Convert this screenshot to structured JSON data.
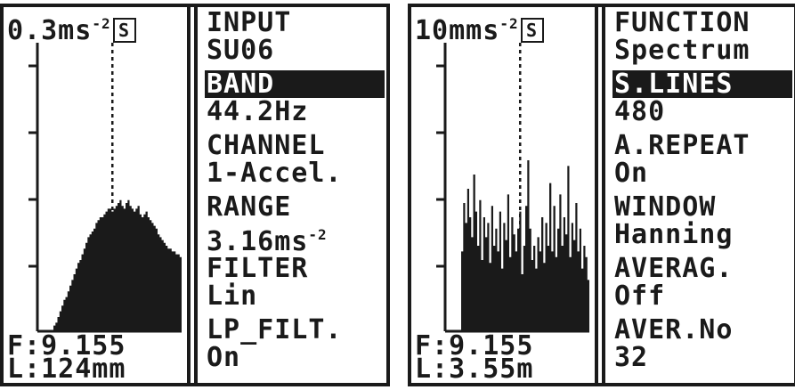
{
  "screens": [
    {
      "scale_value": "0.3ms",
      "scale_exp": "-2",
      "auto_glyph": "S",
      "readout_f": "F:9.155",
      "readout_l": "L:124mm",
      "spectrum": [
        0,
        0,
        0,
        0,
        0,
        0,
        0,
        0,
        2,
        3,
        5,
        7,
        9,
        11,
        12,
        14,
        16,
        18,
        20,
        22,
        24,
        25,
        27,
        29,
        31,
        33,
        34,
        35,
        36,
        38,
        39,
        40,
        40,
        41,
        42,
        43,
        43,
        42,
        43,
        44,
        45,
        46,
        44,
        43,
        45,
        46,
        44,
        43,
        42,
        43,
        44,
        41,
        40,
        41,
        42,
        40,
        39,
        38,
        37,
        36,
        34,
        33,
        32,
        31,
        30,
        29,
        29,
        28,
        28,
        27,
        27,
        26
      ],
      "menu": [
        {
          "label": "INPUT",
          "value": "SU06",
          "selected": false
        },
        {
          "label": "BAND",
          "value": "44.2Hz",
          "selected": true
        },
        {
          "label": "CHANNEL",
          "value": "1-Accel.",
          "selected": false
        },
        {
          "label": "RANGE",
          "value": "3.16ms",
          "value_exp": "-2",
          "selected": false
        },
        {
          "label": "FILTER",
          "value": "Lin",
          "selected": false
        },
        {
          "label": "LP_FILT.",
          "value": "On",
          "selected": false
        }
      ]
    },
    {
      "scale_value": "10mms",
      "scale_exp": "-2",
      "auto_glyph": "S",
      "readout_f": "F:9.155",
      "readout_l": "L:3.55m",
      "spectrum": [
        0,
        0,
        0,
        0,
        0,
        0,
        0,
        0,
        28,
        45,
        38,
        50,
        40,
        33,
        55,
        42,
        30,
        46,
        25,
        40,
        33,
        38,
        24,
        44,
        30,
        36,
        28,
        42,
        22,
        38,
        32,
        48,
        26,
        40,
        34,
        28,
        36,
        42,
        20,
        30,
        44,
        60,
        36,
        25,
        30,
        22,
        33,
        28,
        40,
        24,
        38,
        30,
        52,
        28,
        44,
        26,
        36,
        48,
        30,
        40,
        34,
        58,
        26,
        38,
        32,
        45,
        28,
        36,
        22,
        30,
        26,
        18
      ],
      "menu": [
        {
          "label": "FUNCTION",
          "value": "Spectrum",
          "selected": false
        },
        {
          "label": "S.LINES",
          "value": "480",
          "selected": true
        },
        {
          "label": "A.REPEAT",
          "value": "On",
          "selected": false
        },
        {
          "label": "WINDOW",
          "value": "Hanning",
          "selected": false
        },
        {
          "label": "AVERAG.",
          "value": "Off",
          "selected": false
        },
        {
          "label": "AVER.No",
          "value": "32",
          "selected": false
        }
      ]
    }
  ],
  "colors": {
    "ink": "#1a1a1a",
    "paper": "#ffffff"
  }
}
